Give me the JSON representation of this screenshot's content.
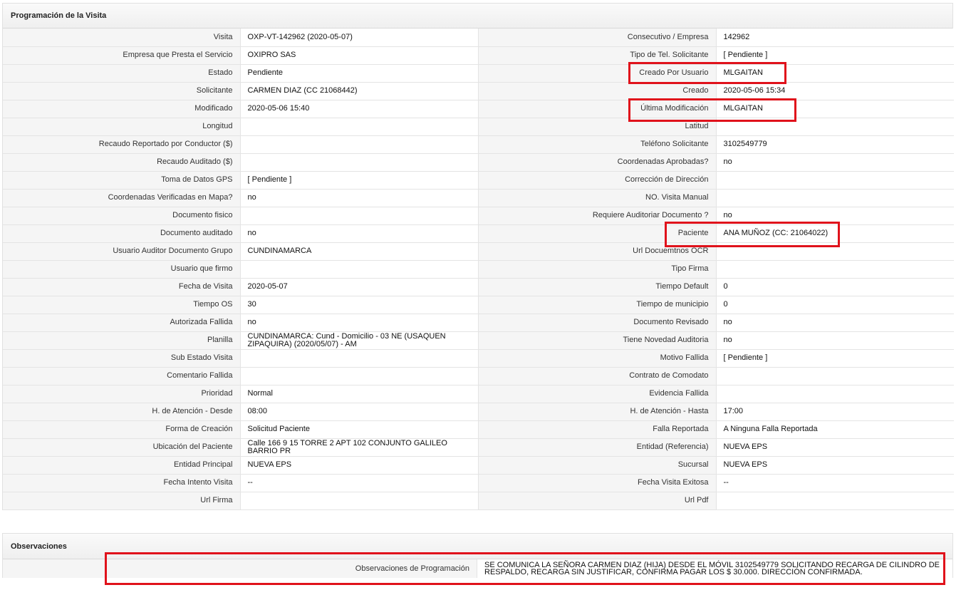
{
  "sections": {
    "visita_title": "Programación de la Visita",
    "obs_title": "Observaciones"
  },
  "rows": [
    {
      "l1": "Visita",
      "v1": "OXP-VT-142962 (2020-05-07)",
      "l2": "Consecutivo / Empresa",
      "v2": "142962"
    },
    {
      "l1": "Empresa que Presta el Servicio",
      "v1": "OXIPRO SAS",
      "l2": "Tipo de Tel. Solicitante",
      "v2": "[ Pendiente ]"
    },
    {
      "l1": "Estado",
      "v1": "Pendiente",
      "l2": "Creado Por Usuario",
      "v2": "MLGAITAN"
    },
    {
      "l1": "Solicitante",
      "v1": "CARMEN DIAZ (CC 21068442)",
      "l2": "Creado",
      "v2": "2020-05-06 15:34"
    },
    {
      "l1": "Modificado",
      "v1": "2020-05-06 15:40",
      "l2": "Última Modificación",
      "v2": " MLGAITAN"
    },
    {
      "l1": "Longitud",
      "v1": "",
      "l2": "Latitud",
      "v2": ""
    },
    {
      "l1": "Recaudo Reportado por Conductor ($)",
      "v1": "",
      "l2": "Teléfono Solicitante",
      "v2": "3102549779"
    },
    {
      "l1": "Recaudo Auditado ($)",
      "v1": "",
      "l2": "Coordenadas Aprobadas?",
      "v2": " no"
    },
    {
      "l1": "Toma de Datos GPS",
      "v1": "[ Pendiente ]",
      "l2": "Corrección de Dirección",
      "v2": ""
    },
    {
      "l1": "Coordenadas Verificadas en Mapa?",
      "v1": " no",
      "l2": "NO. Visita Manual",
      "v2": ""
    },
    {
      "l1": "Documento fisico",
      "v1": "",
      "l2": "Requiere Auditoriar Documento ?",
      "v2": " no"
    },
    {
      "l1": "Documento auditado",
      "v1": " no",
      "l2": "Paciente",
      "v2": "ANA MUÑOZ (CC: 21064022)"
    },
    {
      "l1": "Usuario Auditor Documento Grupo",
      "v1": "CUNDINAMARCA",
      "l2": "Url Docuemtnos OCR",
      "v2": ""
    },
    {
      "l1": "Usuario que firmo",
      "v1": "",
      "l2": "Tipo Firma",
      "v2": ""
    },
    {
      "l1": "Fecha de Visita",
      "v1": " 2020-05-07",
      "l2": "Tiempo Default",
      "v2": "0"
    },
    {
      "l1": "Tiempo OS",
      "v1": "30",
      "l2": "Tiempo de municipio",
      "v2": "0"
    },
    {
      "l1": "Autorizada Fallida",
      "v1": " no",
      "l2": "Documento Revisado",
      "v2": " no"
    },
    {
      "l1": "Planilla",
      "v1": "CUNDINAMARCA: Cund - Domicilio - 03 NE (USAQUEN ZIPAQUIRA) (2020/05/07) - AM",
      "l2": "Tiene Novedad Auditoria",
      "v2": " no"
    },
    {
      "l1": "Sub Estado Visita",
      "v1": "",
      "l2": "Motivo Fallida",
      "v2": "[ Pendiente ]"
    },
    {
      "l1": "Comentario Fallida",
      "v1": "",
      "l2": "Contrato de Comodato",
      "v2": ""
    },
    {
      "l1": "Prioridad",
      "v1": "Normal",
      "l2": "Evidencia Fallida",
      "v2": ""
    },
    {
      "l1": "H. de Atención - Desde",
      "v1": "08:00",
      "l2": "H. de Atención - Hasta",
      "v2": "17:00"
    },
    {
      "l1": "Forma de Creación",
      "v1": "Solicitud Paciente",
      "l2": "Falla Reportada",
      "v2": "A Ninguna Falla Reportada"
    },
    {
      "l1": "Ubicación del Paciente",
      "v1": "Calle 166 9 15 TORRE 2 APT 102 CONJUNTO GALILEO BARRIO PR",
      "l2": "Entidad (Referencia)",
      "v2": "NUEVA EPS"
    },
    {
      "l1": "Entidad Principal",
      "v1": "NUEVA EPS",
      "l2": "Sucursal",
      "v2": "NUEVA EPS"
    },
    {
      "l1": "Fecha Intento Visita",
      "v1": " --",
      "l2": "Fecha Visita Exitosa",
      "v2": " --"
    },
    {
      "l1": "Url Firma",
      "v1": "",
      "l2": "Url Pdf",
      "v2": ""
    }
  ],
  "observaciones": {
    "label": "Observaciones de Programación",
    "value": " SE COMUNICA LA SEÑORA CARMEN DIAZ (HIJA) DESDE EL MÓVIL 3102549779 SOLICITANDO RECARGA DE CILINDRO DE RESPALDO, RECARGA SIN JUSTIFICAR, CONFIRMA PAGAR LOS $ 30.000. DIRECCIÓN CONFIRMADA."
  },
  "colors": {
    "highlight": "#e0121b",
    "label_bg": "#f5f5f5",
    "border": "#e4e4e4"
  }
}
